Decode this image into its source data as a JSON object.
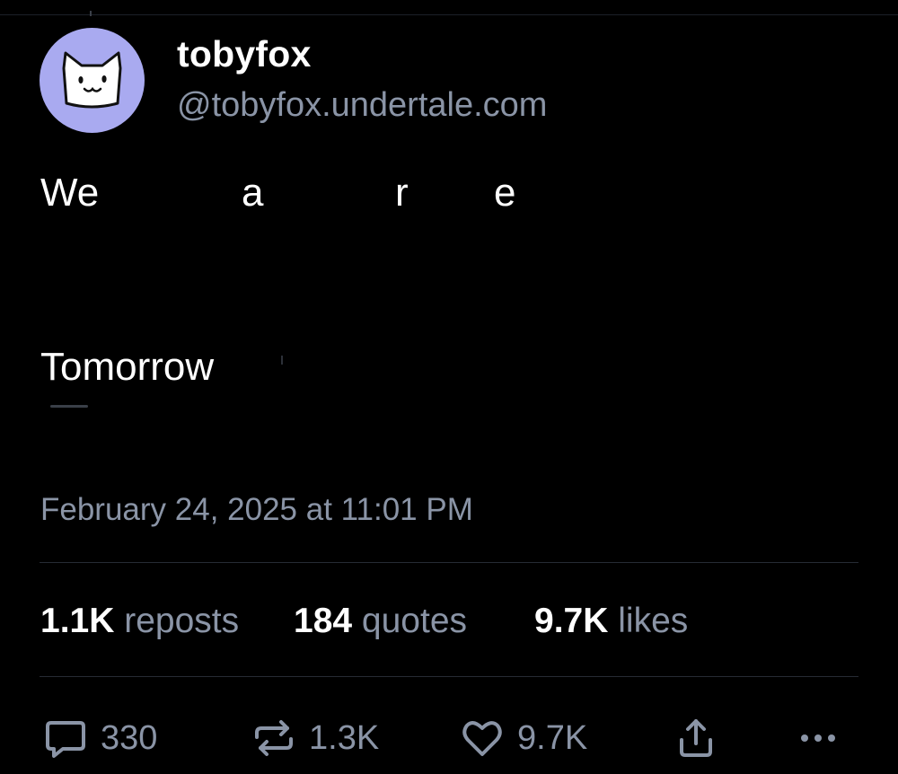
{
  "author": {
    "display_name": "tobyfox",
    "handle": "@tobyfox.undertale.com",
    "avatar_icon": "white-dog-icon",
    "avatar_bg": "#a9aaf0"
  },
  "post": {
    "line1_words": [
      "We",
      "a",
      "r",
      "e"
    ],
    "line2": "Tomorrow",
    "timestamp": "February 24, 2025 at 11:01 PM"
  },
  "stats": {
    "reposts_count": "1.1K",
    "reposts_label": "reposts",
    "quotes_count": "184",
    "quotes_label": "quotes",
    "likes_count": "9.7K",
    "likes_label": "likes"
  },
  "actions": {
    "reply_count": "330",
    "repost_count": "1.3K",
    "like_count": "9.7K",
    "share_icon": "share-icon",
    "more_icon": "more-icon"
  },
  "colors": {
    "background": "#000000",
    "text_primary": "#ffffff",
    "text_secondary": "#8a94a6",
    "divider": "#262b34"
  }
}
